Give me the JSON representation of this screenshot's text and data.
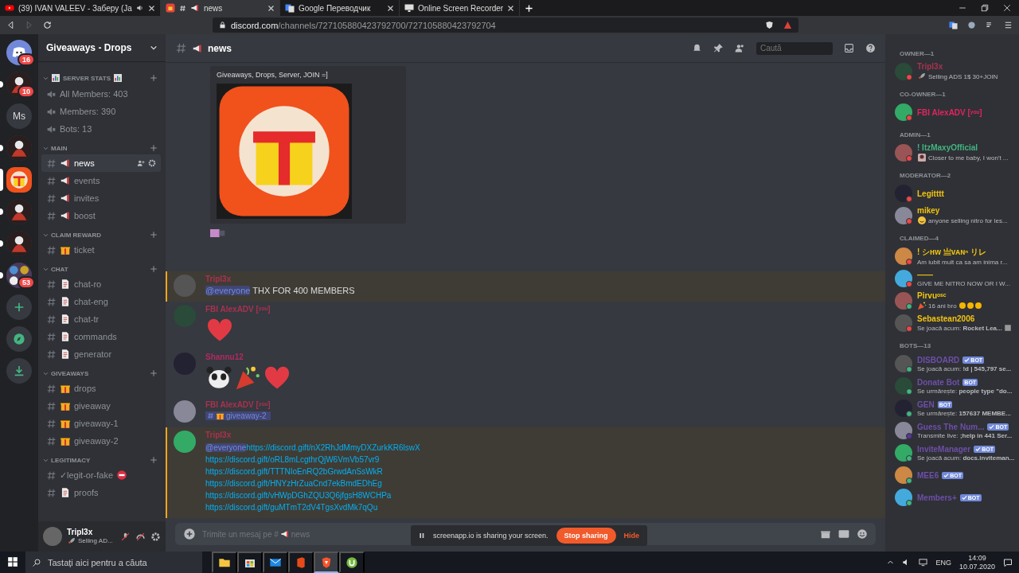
{
  "browser": {
    "tabs": [
      {
        "kind": "video",
        "title": "(39) IVAN VALEEV - Заберу (Ja",
        "audio": true,
        "selected": false
      },
      {
        "kind": "channel",
        "title": "news",
        "audio": false,
        "selected": true
      },
      {
        "kind": "translate",
        "title": "Google Переводчик",
        "audio": false,
        "selected": false
      },
      {
        "kind": "recorder",
        "title": "Online Screen Recorder",
        "audio": false,
        "selected": false
      }
    ],
    "url": {
      "host": "discord.com",
      "path": "/channels/727105880423792700/727105880423792704"
    }
  },
  "servers": [
    {
      "kind": "home",
      "badge": "16",
      "unread": false,
      "selected": false
    },
    {
      "kind": "avatar",
      "badge": "10",
      "unread": true,
      "selected": false
    },
    {
      "kind": "text",
      "label": "Ms",
      "unread": false,
      "selected": false
    },
    {
      "kind": "avatar",
      "unread": true,
      "selected": false
    },
    {
      "kind": "gift",
      "unread": false,
      "selected": true
    },
    {
      "kind": "avatar",
      "unread": true,
      "selected": false
    },
    {
      "kind": "avatar",
      "unread": true,
      "selected": false
    },
    {
      "kind": "folder",
      "badge": "53",
      "unread": true,
      "selected": false
    },
    {
      "kind": "add",
      "unread": false,
      "selected": false
    },
    {
      "kind": "explore",
      "unread": false,
      "selected": false
    },
    {
      "kind": "download",
      "unread": false,
      "selected": false
    }
  ],
  "sidebar": {
    "title": "Giveaways - Drops",
    "categories": [
      {
        "name": "SERVER STATS",
        "kind": "stats",
        "channels": [
          {
            "kind": "voice",
            "name": "All Members: 403",
            "selected": false
          },
          {
            "kind": "voice",
            "name": "Members: 390",
            "selected": false
          },
          {
            "kind": "voice",
            "name": "Bots: 13",
            "selected": false
          }
        ]
      },
      {
        "name": "MAIN",
        "kind": "plain",
        "channels": [
          {
            "kind": "megaphone",
            "name": "news",
            "selected": true
          },
          {
            "kind": "megaphone",
            "name": "events",
            "selected": false
          },
          {
            "kind": "megaphone",
            "name": "invites",
            "selected": false
          },
          {
            "kind": "megaphone",
            "name": "boost",
            "selected": false
          }
        ]
      },
      {
        "name": "CLAIM REWARD",
        "kind": "plain",
        "channels": [
          {
            "kind": "gift",
            "name": "ticket",
            "selected": false
          }
        ]
      },
      {
        "name": "CHAT",
        "kind": "plain",
        "channels": [
          {
            "kind": "page",
            "name": "chat-ro",
            "selected": false
          },
          {
            "kind": "page",
            "name": "chat-eng",
            "selected": false
          },
          {
            "kind": "page",
            "name": "chat-tr",
            "selected": false
          },
          {
            "kind": "page",
            "name": "commands",
            "selected": false
          },
          {
            "kind": "page",
            "name": "generator",
            "selected": false
          }
        ]
      },
      {
        "name": "GIVEAWAYS",
        "kind": "plain",
        "channels": [
          {
            "kind": "gift",
            "name": "drops",
            "selected": false
          },
          {
            "kind": "gift",
            "name": "giveaway",
            "selected": false
          },
          {
            "kind": "gift",
            "name": "giveaway-1",
            "selected": false
          },
          {
            "kind": "gift",
            "name": "giveaway-2",
            "selected": false
          }
        ]
      },
      {
        "name": "LEGITIMACY",
        "kind": "plain",
        "channels": [
          {
            "kind": "flagged",
            "name": "✓legit-or-fake",
            "selected": false
          },
          {
            "kind": "page",
            "name": "proofs",
            "selected": false
          }
        ]
      }
    ],
    "user": {
      "name": "Tripl3x",
      "status": {
        "kind": "rocket",
        "text": "Selling AD..."
      }
    }
  },
  "chat": {
    "channel": "news",
    "search_placeholder": "Caută",
    "embed": {
      "text": "Giveaways, Drops, Server, JOIN =]"
    },
    "messages": [
      {
        "author": "Tripl3x",
        "color": "#a8324f",
        "mentioned": true,
        "kind": "text",
        "mention": "@everyone",
        "text": "THX FOR 400 MEMBERS"
      },
      {
        "author": "FBI AlexADV [ʸᵒᵘ]",
        "color": "#a8324f",
        "mentioned": false,
        "kind": "emoji",
        "emojis": [
          {
            "kind": "heart"
          }
        ]
      },
      {
        "author": "Shannu12",
        "color": "#b02a63",
        "mentioned": false,
        "kind": "emoji",
        "emojis": [
          {
            "kind": "panda"
          },
          {
            "kind": "popper"
          },
          {
            "kind": "heart"
          }
        ]
      },
      {
        "author": "FBI AlexADV [ʸᵒᵘ]",
        "color": "#a8324f",
        "mentioned": false,
        "kind": "channel",
        "channel": "giveaway-2"
      },
      {
        "author": "Tripl3x",
        "color": "#a8324f",
        "mentioned": true,
        "kind": "links",
        "mention": "@everyone",
        "links": [
          "https://discord.gift/nX2RhJdMmyDXZurkKR6lswX",
          "https://discord.gift/oRL8mLcgthrQjW6VmVb57vr9",
          "https://discord.gift/TTTNIoEnRQ2bGrwdAnSsWkR",
          "https://discord.gift/HNYzHrZuaCnd7ekBmdEDhEg",
          "https://discord.gift/vHWpDGhZQU3Q6jfgsH8WCHPa",
          "https://discord.gift/guMTmT2dV4TgsXvdMk7qQu"
        ]
      }
    ],
    "composer": {
      "prefix": "Trimite un mesaj pe #",
      "channel": "news"
    }
  },
  "members": [
    {
      "title": "OWNER—1",
      "members": [
        {
          "name": "Tripl3x",
          "color": "#a8324f",
          "kind": "dnd",
          "activity": {
            "kind": "rocket",
            "text": "Selling ADS 1$ 30+JOIN"
          }
        }
      ]
    },
    {
      "title": "CO-OWNER—1",
      "members": [
        {
          "name": "FBI AlexADV [ʸᵒᵘ]",
          "color": "#e0245e",
          "kind": "dnd"
        }
      ]
    },
    {
      "title": "ADMIN—1",
      "members": [
        {
          "name": "! ItzMaxyOfficial",
          "color": "#43b581",
          "kind": "dnd",
          "activity": {
            "kind": "photo",
            "text": "Closer to me baby, I won't ..."
          }
        }
      ]
    },
    {
      "title": "MODERATOR—2",
      "members": [
        {
          "name": "Legitttt",
          "color": "#f1c40f",
          "kind": "dnd"
        },
        {
          "name": "mikey",
          "color": "#f1c40f",
          "kind": "dnd",
          "activity": {
            "kind": "smiley",
            "text": "anyone selling nitro for les..."
          }
        }
      ]
    },
    {
      "title": "CLAIMED—4",
      "members": [
        {
          "name": "! シʜᴡ 亗ᴠᴀɴⁿ リレ",
          "color": "#f1c40f",
          "kind": "dnd",
          "activity": {
            "kind": "plain",
            "text": "Am iubit mult ca sa am inima r..."
          }
        },
        {
          "name": "——",
          "color": "#f1c40f",
          "kind": "dnd",
          "activity": {
            "kind": "plain",
            "text": "GIVE ME NITRO NOW OR I W..."
          }
        },
        {
          "name": "Pirvuᵒˢᶜ",
          "color": "#f1c40f",
          "kind": "mobile",
          "activity": {
            "kind": "popper",
            "text": "16 ani bro"
          },
          "trailing": {
            "kind": "muscle"
          }
        },
        {
          "name": "Sebastean2006",
          "color": "#f1c40f",
          "kind": "dnd",
          "activity": {
            "kind": "plain",
            "text": "Se joacă acum: **Rocket Lea...**"
          },
          "trailing": {
            "kind": "card"
          }
        }
      ]
    },
    {
      "title": "BOTS—13",
      "members": [
        {
          "name": "DISBOARD",
          "color": "#6e4fa8",
          "kind": "online",
          "tag": {
            "label": "BOT",
            "verified": true
          },
          "activity": {
            "kind": "plain",
            "text": "Se joacă acum: **!d | 545,797 se...**"
          }
        },
        {
          "name": "Donate Bot",
          "color": "#6e4fa8",
          "kind": "online",
          "tag": {
            "label": "BOT",
            "verified": false
          },
          "activity": {
            "kind": "plain",
            "text": "Se urmărește: **people type \"do...**"
          }
        },
        {
          "name": "GEN",
          "color": "#6e4fa8",
          "kind": "online",
          "tag": {
            "label": "BOT",
            "verified": false
          },
          "activity": {
            "kind": "plain",
            "text": "Se urmărește: **157637 MEMBE...**"
          }
        },
        {
          "name": "Guess The Num...",
          "color": "#6e4fa8",
          "kind": "streaming",
          "tag": {
            "label": "BOT",
            "verified": true
          },
          "activity": {
            "kind": "plain",
            "text": "Transmite live: **;help in 441 Ser...**"
          }
        },
        {
          "name": "InviteManager",
          "color": "#6e4fa8",
          "kind": "online",
          "tag": {
            "label": "BOT",
            "verified": true
          },
          "activity": {
            "kind": "plain",
            "text": "Se joacă acum: **docs.inviteman...**"
          }
        },
        {
          "name": "MEE6",
          "color": "#6e4fa8",
          "kind": "online",
          "tag": {
            "label": "BOT",
            "verified": true
          }
        },
        {
          "name": "Members+",
          "color": "#6e4fa8",
          "kind": "online",
          "tag": {
            "label": "BOT",
            "verified": true
          }
        }
      ]
    }
  ],
  "share_bar": {
    "message": "screenapp.io is sharing your screen.",
    "stop": "Stop sharing",
    "hide": "Hide"
  },
  "taskbar": {
    "search_placeholder": "Tastați aici pentru a căuta",
    "apps": [
      {
        "kind": "folder",
        "active": false
      },
      {
        "kind": "store",
        "active": false
      },
      {
        "kind": "mail",
        "active": false
      },
      {
        "kind": "office",
        "active": false
      },
      {
        "kind": "browser",
        "active": true
      },
      {
        "kind": "torrent",
        "active": false
      }
    ],
    "lang": "ENG",
    "time": "14:09",
    "date": "10.07.2020"
  }
}
